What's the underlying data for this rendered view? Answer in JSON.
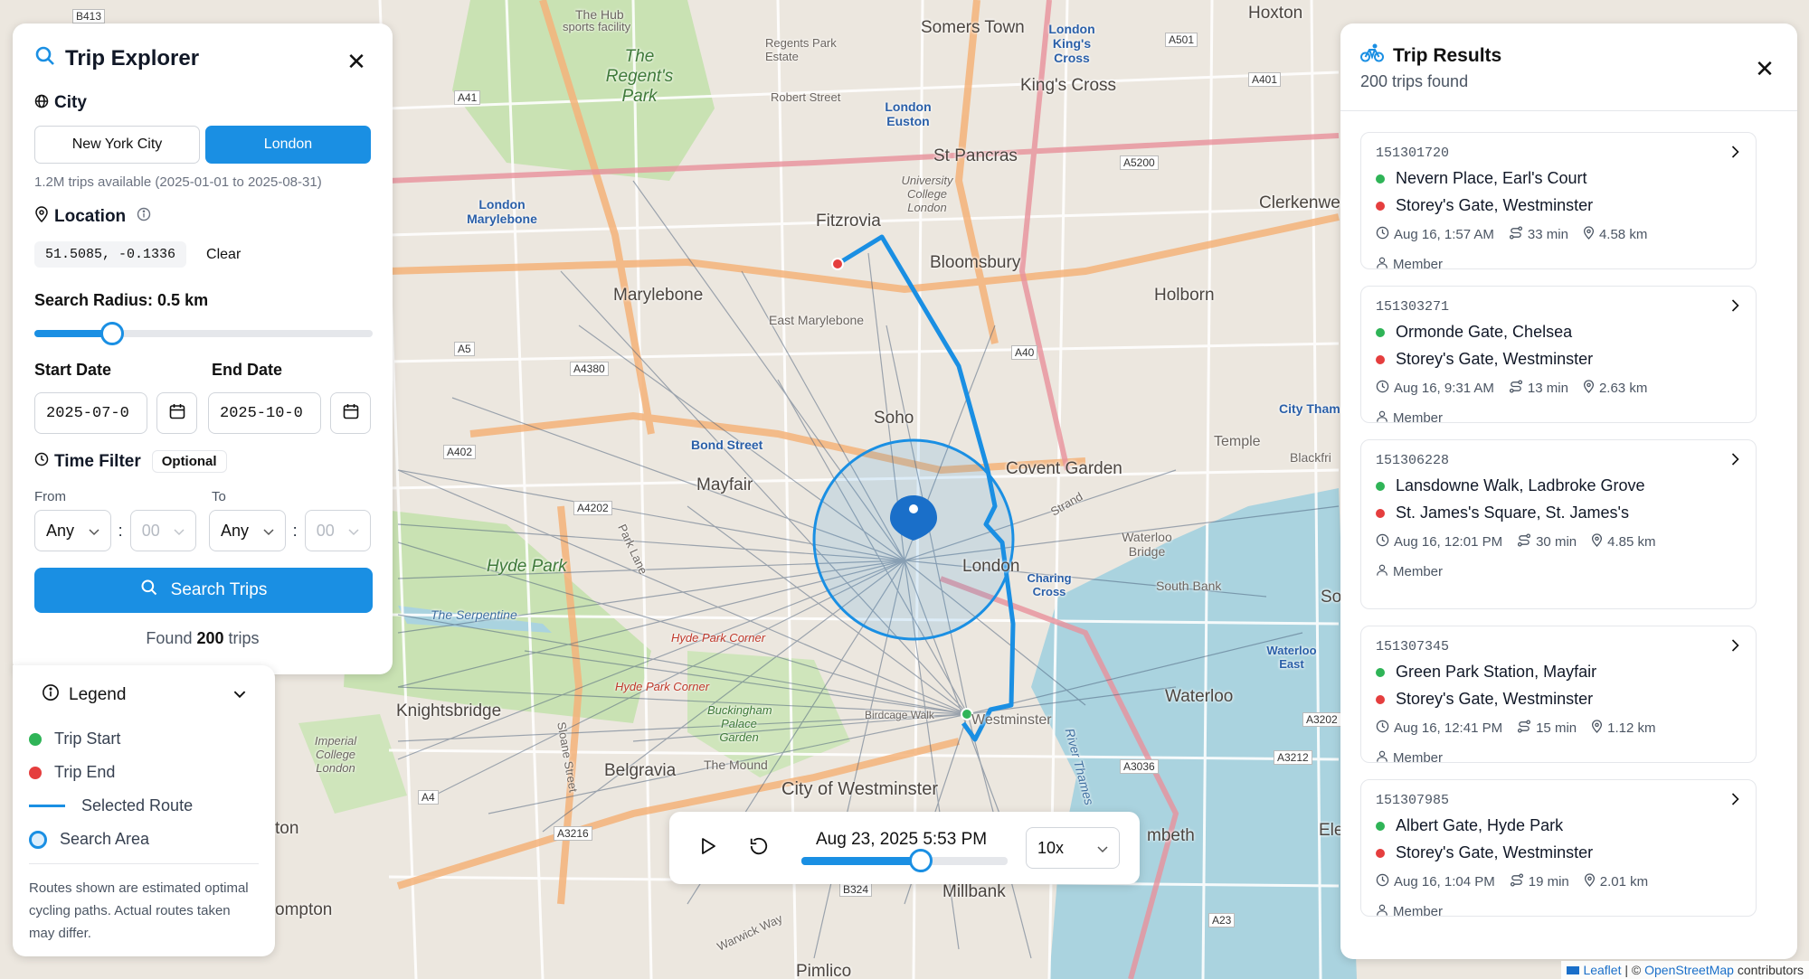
{
  "explorer": {
    "title": "Trip Explorer",
    "city_label": "City",
    "cities": [
      "New York City",
      "London"
    ],
    "selected_city": "London",
    "availability": "1.2M trips available (2025-01-01 to 2025-08-31)",
    "location_label": "Location",
    "coords": "51.5085, -0.1336",
    "clear_label": "Clear",
    "radius_label": "Search Radius: 0.5 km",
    "radius_fraction": 0.23,
    "start_label": "Start Date",
    "start_value": "2025-07-0",
    "end_label": "End Date",
    "end_value": "2025-10-0",
    "time_filter_label": "Time Filter",
    "optional_badge": "Optional",
    "from_label": "From",
    "to_label": "To",
    "from_hour": "Any",
    "from_minute": "00",
    "to_hour": "Any",
    "to_minute": "00",
    "colon": ":",
    "search_label": "Search Trips",
    "found_prefix": "Found",
    "found_count": "200",
    "found_suffix": "trips"
  },
  "legend": {
    "title": "Legend",
    "items": [
      {
        "label": "Trip Start",
        "color": "#2fb457"
      },
      {
        "label": "Trip End",
        "color": "#e53e3e"
      },
      {
        "label": "Selected Route",
        "color": "#1a8fe3"
      },
      {
        "label": "Search Area",
        "color": "#1a8fe3"
      }
    ],
    "note": "Routes shown are estimated optimal cycling paths. Actual routes taken may differ."
  },
  "results": {
    "title": "Trip Results",
    "subtitle": "200 trips found",
    "trips": [
      {
        "id": "151301720",
        "start": "Nevern Place, Earl's Court",
        "end": "Storey's Gate, Westminster",
        "time": "Aug 16, 1:57 AM",
        "duration": "33 min",
        "distance": "4.58 km",
        "user": "Member"
      },
      {
        "id": "151303271",
        "start": "Ormonde Gate, Chelsea",
        "end": "Storey's Gate, Westminster",
        "time": "Aug 16, 9:31 AM",
        "duration": "13 min",
        "distance": "2.63 km",
        "user": "Member"
      },
      {
        "id": "151306228",
        "start": "Lansdowne Walk, Ladbroke Grove",
        "end": "St. James's Square, St. James's",
        "time": "Aug 16, 12:01 PM",
        "duration": "30 min",
        "distance": "4.85 km",
        "user": "Member"
      },
      {
        "id": "151307345",
        "start": "Green Park Station, Mayfair",
        "end": "Storey's Gate, Westminster",
        "time": "Aug 16, 12:41 PM",
        "duration": "15 min",
        "distance": "1.12 km",
        "user": "Member"
      },
      {
        "id": "151307985",
        "start": "Albert Gate, Hyde Park",
        "end": "Storey's Gate, Westminster",
        "time": "Aug 16, 1:04 PM",
        "duration": "19 min",
        "distance": "2.01 km",
        "user": "Member"
      }
    ]
  },
  "playback": {
    "timestamp": "Aug 23, 2025 5:53 PM",
    "progress_fraction": 0.58,
    "speed": "10x"
  },
  "map": {
    "labels": {
      "hub": "The Hub",
      "sports": "sports facility",
      "regents_park": "The Regent's Park",
      "regents_estate": "Regents Park Estate",
      "somers_town": "Somers Town",
      "london_kings_cross": "London King's Cross",
      "kings_cross": "King's Cross",
      "hoxton": "Hoxton",
      "robert_street": "Robert Street",
      "london_euston": "London Euston",
      "st_pancras": "St Pancras",
      "university_college": "University College London",
      "clerkenwell": "Clerkenwell",
      "fitzrovia": "Fitzrovia",
      "bloomsbury": "Bloomsbury",
      "london_marylebone": "London Marylebone",
      "marylebone": "Marylebone",
      "east_marylebone": "East Marylebone",
      "holborn": "Holborn",
      "soho": "Soho",
      "bond_street": "Bond Street",
      "mayfair": "Mayfair",
      "covent_garden": "Covent Garden",
      "temple": "Temple",
      "city_thameslink": "City Tham",
      "blackfriars": "Blackfri",
      "hyde_park": "Hyde Park",
      "serpentine": "The Serpentine",
      "london": "London",
      "charing_cross": "Charing Cross",
      "waterloo_bridge": "Waterloo Bridge",
      "south_bank": "South Bank",
      "waterloo_east": "Waterloo East",
      "waterloo": "Waterloo",
      "knightsbridge": "Knightsbridge",
      "hyde_park_corner": "Hyde Park Corner",
      "buckingham": "Buckingham Palace Garden",
      "westminster": "Westminster",
      "birdcage_walk": "Birdcage Walk",
      "imperial": "Imperial College London",
      "belgravia": "Belgravia",
      "the_mound": "The Mound",
      "city_of_westminster": "City of Westminster",
      "lambeth": "mbeth",
      "millbank": "Millbank",
      "kensington": "ton",
      "brompton": "ompton",
      "pimlico": "Pimlico",
      "warwick_way": "Warwick Way",
      "park_lane": "Park Lane",
      "strand": "Strand",
      "sloane_street": "Sloane Street",
      "river_thames": "River Thames",
      "el": "Ele",
      "so": "So"
    },
    "roads": [
      "B413",
      "A41",
      "A501",
      "A401",
      "A5200",
      "A5",
      "A4380",
      "A402",
      "A4202",
      "A40",
      "A4",
      "A3216",
      "A3212",
      "A3036",
      "A3202",
      "A23",
      "B324"
    ],
    "attribution_leaflet": "Leaflet",
    "attribution_sep": "| ©",
    "attribution_osm": "OpenStreetMap",
    "attribution_suffix": "contributors"
  }
}
